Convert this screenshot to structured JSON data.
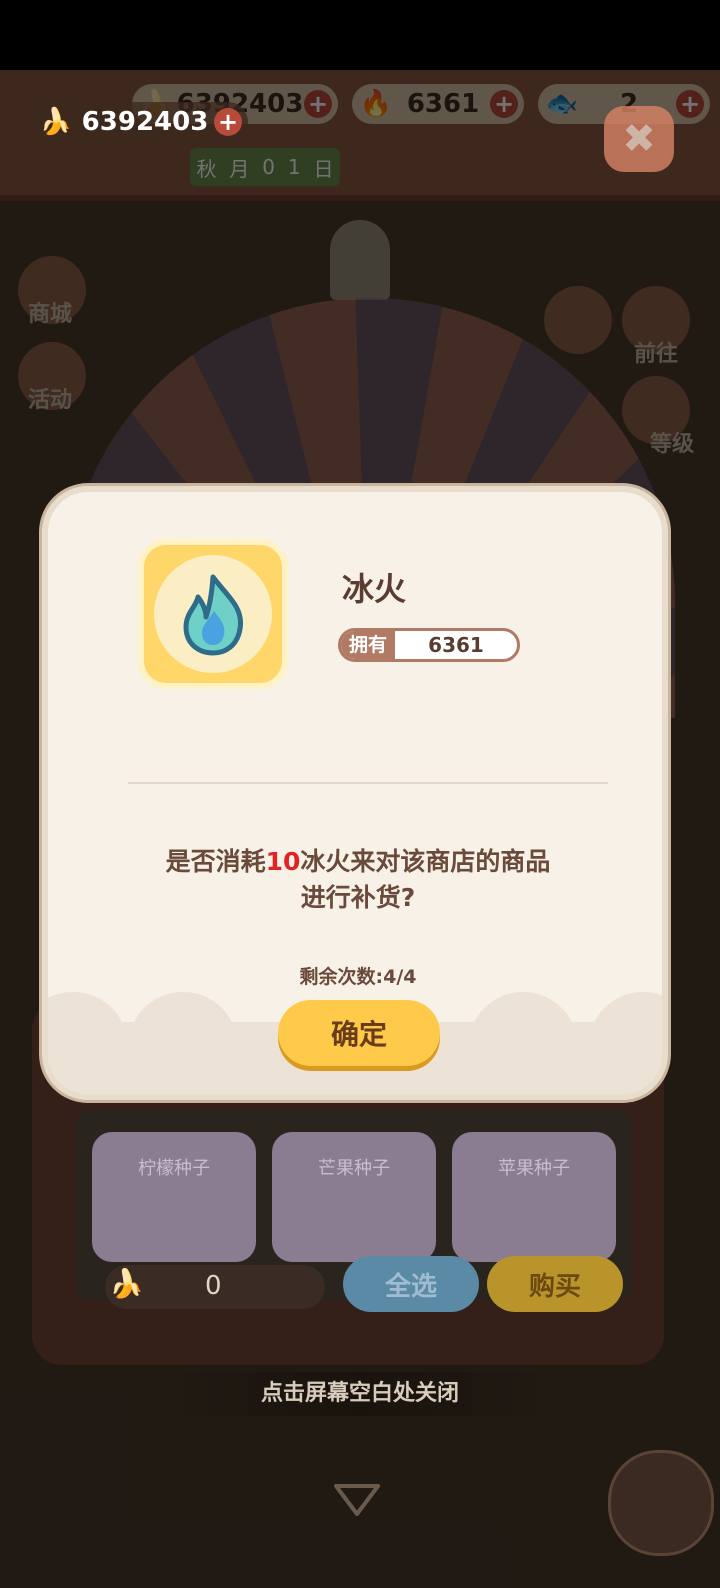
{
  "topbar": {
    "resources": [
      {
        "icon": "banana-icon",
        "value": "6392403"
      },
      {
        "icon": "blue-flame-icon",
        "value": "6361"
      },
      {
        "icon": "fish-icon",
        "value": "2"
      }
    ],
    "main_banana": "6392403",
    "date": [
      "秋",
      "月",
      "0",
      "1",
      "日"
    ]
  },
  "side_menu": {
    "left": [
      {
        "label": "商城"
      },
      {
        "label": "活动"
      }
    ],
    "right": [
      {
        "label": "前往"
      },
      {
        "label": "等级"
      }
    ]
  },
  "dialog": {
    "item_name": "冰火",
    "own_label": "拥有",
    "own_value": "6361",
    "question_pre": "是否消耗",
    "question_amount": "10",
    "question_post": "冰火来对该商店的商品进行补货?",
    "remaining": "剩余次数:4/4",
    "confirm_label": "确定"
  },
  "shop": {
    "cards": [
      {
        "label": "柠檬种子"
      },
      {
        "label": "芒果种子"
      },
      {
        "label": "苹果种子"
      }
    ],
    "count": "0",
    "select_all_label": "全选",
    "buy_label": "购买"
  },
  "close_tip": "点击屏幕空白处关闭",
  "colors": {
    "accent_yellow": "#ffc94a",
    "highlight_red": "#e02424",
    "dialog_bg": "#f8f1e7"
  }
}
